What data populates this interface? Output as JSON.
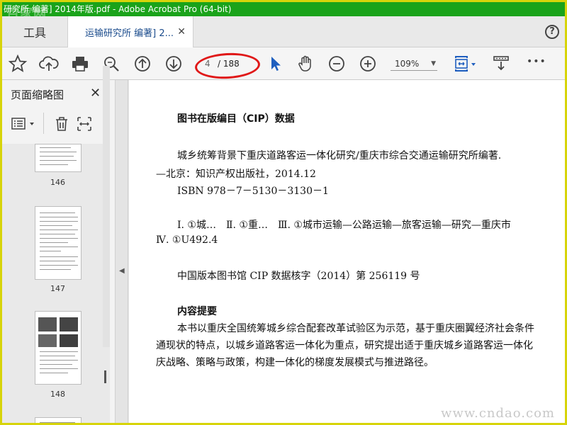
{
  "window": {
    "title": "研究所 编著] 2014年版.pdf - Adobe Acrobat Pro (64-bit)"
  },
  "watermark_top": "百家网",
  "tabs": {
    "tools_label": "工具",
    "doc_label": "运输研究所 编著] 2...",
    "close_symbol": "✕",
    "help_symbol": "?"
  },
  "toolbar": {
    "page_current": "4",
    "page_total": "/ 188",
    "zoom": "109%",
    "more": "•••",
    "accent": "#1f5fbf"
  },
  "sidebar": {
    "title": "页面缩略图",
    "close_symbol": "✕",
    "thumbnails": [
      {
        "label": "146"
      },
      {
        "label": "147"
      },
      {
        "label": "148"
      }
    ]
  },
  "document": {
    "lines": [
      "图书在版编目（CIP）数据",
      "城乡统筹背景下重庆道路客运一体化研究/重庆市综合交通运输研究所编著.",
      "—北京：知识产权出版社，2014.12",
      "ISBN 978－7－5130－3130－1",
      "Ⅰ. ①城…　Ⅱ. ①重…　Ⅲ. ①城市运输—公路运输—旅客运输—研究—重庆市",
      "Ⅳ. ①U492.4",
      "中国版本图书馆 CIP 数据核字（2014）第 256119 号",
      "内容提要",
      "本书以重庆全国统筹城乡综合配套改革试验区为示范，基于重庆圈翼经济社会条件",
      "通现状的特点，以城乡道路客运一体化为重点，研究提出适于重庆城乡道路客运一体化",
      "庆战略、策略与政策，构建一体化的梯度发展模式与推进路径。"
    ]
  },
  "watermark_bottom": "www.cndao.com"
}
